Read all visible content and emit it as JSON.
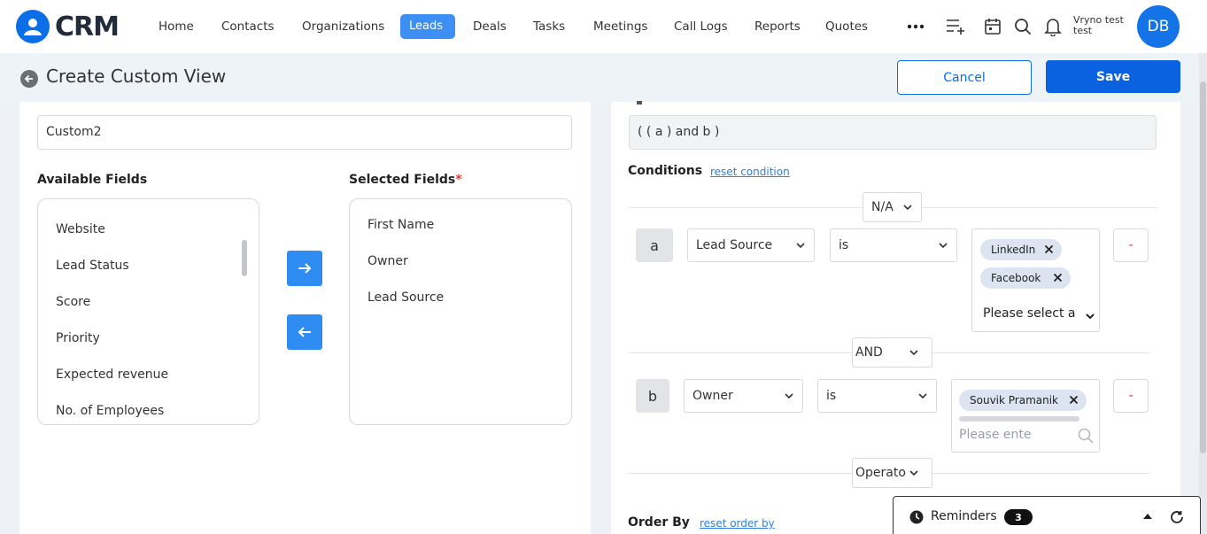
{
  "app": {
    "logo_text": "CRM"
  },
  "nav": {
    "items": [
      {
        "label": "Home"
      },
      {
        "label": "Contacts"
      },
      {
        "label": "Organizations"
      },
      {
        "label": "Leads"
      },
      {
        "label": "Deals"
      },
      {
        "label": "Tasks"
      },
      {
        "label": "Meetings"
      },
      {
        "label": "Call Logs"
      },
      {
        "label": "Reports"
      },
      {
        "label": "Quotes"
      }
    ],
    "active": "Leads"
  },
  "user": {
    "name_line1": "Vryno test",
    "name_line2": "test",
    "initials": "DB"
  },
  "header": {
    "title": "Create Custom View",
    "cancel_label": "Cancel",
    "save_label": "Save"
  },
  "left": {
    "view_name": "Custom2",
    "available_label": "Available Fields",
    "selected_label": "Selected Fields",
    "required_mark": "*",
    "available_fields": [
      "Website",
      "Lead Status",
      "Score",
      "Priority",
      "Expected revenue",
      "No. of Employees"
    ],
    "selected_fields": [
      "First Name",
      "Owner",
      "Lead Source"
    ]
  },
  "right": {
    "expression": "( ( a ) and b )",
    "conditions_label": "Conditions",
    "reset_condition": "reset condition",
    "top_operator": "N/A",
    "condition_a": {
      "letter": "a",
      "field": "Lead Source",
      "operator": "is",
      "values": [
        "LinkedIn",
        "Facebook"
      ],
      "select_placeholder": "Please select a"
    },
    "join_operator": "AND",
    "condition_b": {
      "letter": "b",
      "field": "Owner",
      "operator": "is",
      "values": [
        "Souvik Pramanik"
      ],
      "search_placeholder": "Please ente"
    },
    "bottom_operator": "Operato",
    "remove_label": "-",
    "order_by_label": "Order By",
    "reset_order_by": "reset order by"
  },
  "reminders": {
    "label": "Reminders",
    "count": "3"
  },
  "colors": {
    "primary": "#0b62e0",
    "active_nav": "#3d8ff3",
    "arrow_button": "#2f8cf3",
    "chip": "#dbe4f0",
    "danger": "#e0323b"
  }
}
